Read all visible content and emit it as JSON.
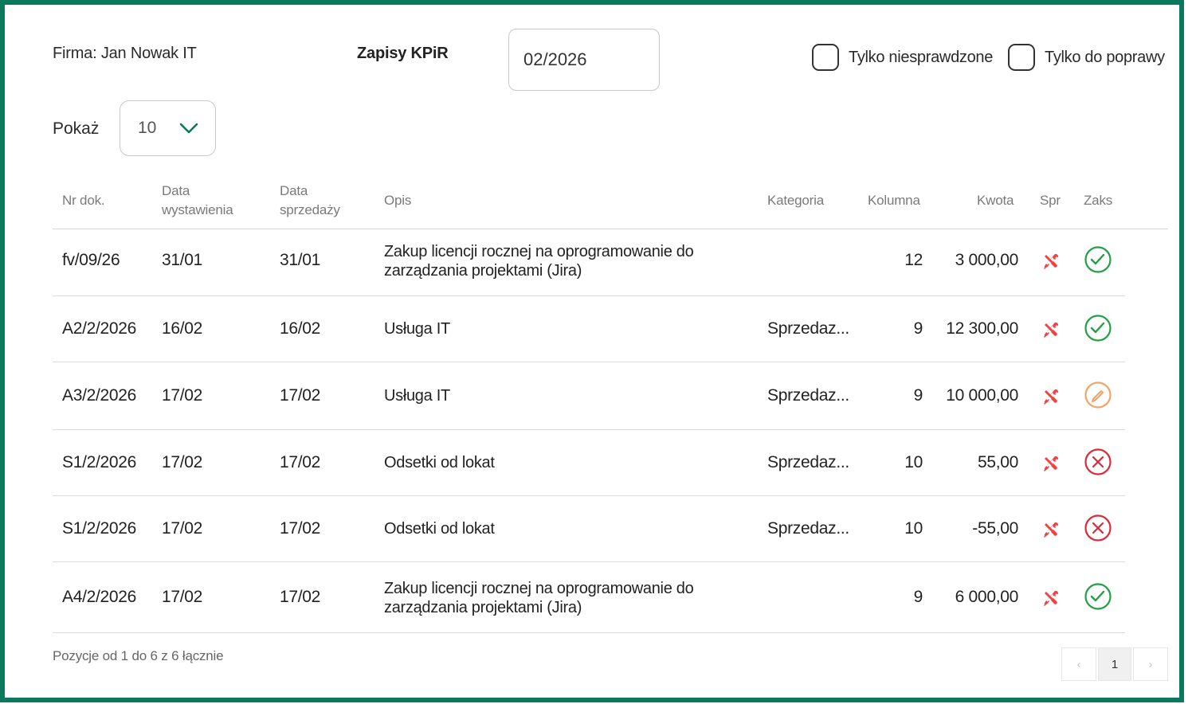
{
  "header": {
    "firma": "Firma: Jan Nowak IT",
    "title": "Zapisy KPiR",
    "month_value": "02/2026",
    "filter_unchecked_label": "Tylko niesprawdzone",
    "filter_correction_label": "Tylko do poprawy"
  },
  "pagesize": {
    "label": "Pokaż",
    "value": "10"
  },
  "table": {
    "columns": {
      "nr": "Nr dok.",
      "data_wyst": "Data wystawienia",
      "data_sprz": "Data sprzedaży",
      "opis": "Opis",
      "kategoria": "Kategoria",
      "kolumna": "Kolumna",
      "kwota": "Kwota",
      "spr": "Spr",
      "zaks": "Zaks"
    },
    "rows": [
      {
        "nr": "fv/09/26",
        "data_wyst": "31/01",
        "data_sprz": "31/01",
        "opis": "Zakup licencji rocznej na oprogramowanie do zarządzania projektami (Jira)",
        "kategoria": "",
        "kolumna": "12",
        "kwota": "3 000,00",
        "status": "ok"
      },
      {
        "nr": "A2/2/2026",
        "data_wyst": "16/02",
        "data_sprz": "16/02",
        "opis": "Usługa IT",
        "kategoria": "Sprzedaz...",
        "kolumna": "9",
        "kwota": "12 300,00",
        "status": "ok"
      },
      {
        "nr": "A3/2/2026",
        "data_wyst": "17/02",
        "data_sprz": "17/02",
        "opis": "Usługa IT",
        "kategoria": "Sprzedaz...",
        "kolumna": "9",
        "kwota": "10 000,00",
        "status": "edit"
      },
      {
        "nr": "S1/2/2026",
        "data_wyst": "17/02",
        "data_sprz": "17/02",
        "opis": "Odsetki od lokat",
        "kategoria": "Sprzedaz...",
        "kolumna": "10",
        "kwota": "55,00",
        "status": "error"
      },
      {
        "nr": "S1/2/2026",
        "data_wyst": "17/02",
        "data_sprz": "17/02",
        "opis": "Odsetki od lokat",
        "kategoria": "Sprzedaz...",
        "kolumna": "10",
        "kwota": "-55,00",
        "status": "error"
      },
      {
        "nr": "A4/2/2026",
        "data_wyst": "17/02",
        "data_sprz": "17/02",
        "opis": "Zakup licencji rocznej na oprogramowanie do zarządzania projektami (Jira)",
        "kategoria": "",
        "kolumna": "9",
        "kwota": "6 000,00",
        "status": "ok"
      }
    ]
  },
  "footer": {
    "info": "Pozycje od 1 do 6 z 6 łącznie",
    "prev": "‹",
    "current_page": "1",
    "next": "›"
  },
  "colors": {
    "border": "#0b7a5c",
    "ok": "#22a045",
    "edit": "#f2a466",
    "error": "#d92b3a",
    "spr_icon": "#f04242"
  },
  "icons": {
    "spr": "tools-icon",
    "ok": "check-circle-icon",
    "edit": "pencil-circle-icon",
    "error": "x-circle-icon"
  }
}
